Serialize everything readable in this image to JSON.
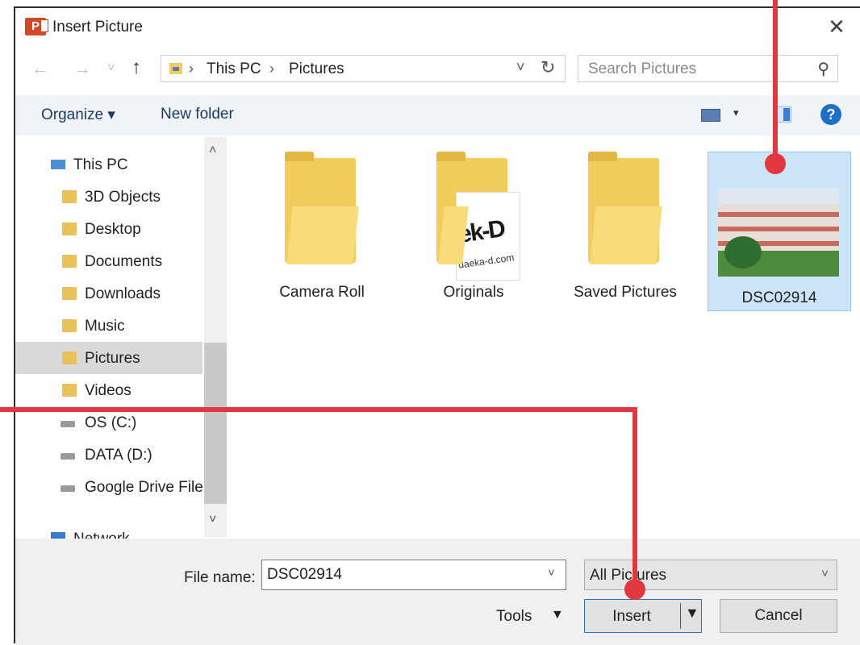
{
  "window": {
    "title": "Insert Picture",
    "close_glyph": "✕",
    "app_icon_letter": "P"
  },
  "nav": {
    "back_glyph": "←",
    "forward_glyph": "→",
    "recent_glyph": "˅",
    "up_glyph": "↑",
    "crumb_sep": "›",
    "breadcrumbs": [
      "This PC",
      "Pictures"
    ],
    "dropdown_glyph": "˅",
    "refresh_glyph": "↻",
    "search_placeholder": "Search Pictures",
    "search_glyph": "⚲"
  },
  "toolbar": {
    "organize": "Organize ▾",
    "new_folder": "New folder",
    "view_dropdown": "▾",
    "help": "?"
  },
  "sidebar": {
    "items": [
      {
        "label": "This PC",
        "icon": "computer-icon"
      },
      {
        "label": "3D Objects",
        "icon": "folder-icon"
      },
      {
        "label": "Desktop",
        "icon": "folder-icon"
      },
      {
        "label": "Documents",
        "icon": "folder-icon"
      },
      {
        "label": "Downloads",
        "icon": "folder-icon"
      },
      {
        "label": "Music",
        "icon": "folder-icon"
      },
      {
        "label": "Pictures",
        "icon": "folder-icon",
        "selected": true
      },
      {
        "label": "Videos",
        "icon": "folder-icon"
      },
      {
        "label": "OS (C:)",
        "icon": "drive-icon"
      },
      {
        "label": "DATA (D:)",
        "icon": "drive-icon"
      },
      {
        "label": "Google Drive File",
        "icon": "drive-icon"
      },
      {
        "label": "Network",
        "icon": "network-icon"
      }
    ],
    "scroll_up": "˄",
    "scroll_down": "˅"
  },
  "content": {
    "items": [
      {
        "label": "Camera Roll",
        "kind": "folder"
      },
      {
        "label": "Originals",
        "kind": "folder-with-image",
        "thumb_text": "ek-D",
        "thumb_sub": "daeka-d.com"
      },
      {
        "label": "Saved Pictures",
        "kind": "folder"
      },
      {
        "label": "DSC02914",
        "kind": "image",
        "selected": true
      }
    ]
  },
  "bottom": {
    "file_name_label": "File name:",
    "file_name_value": "DSC02914",
    "file_type": "All Pictures",
    "dropdown_glyph": "˅",
    "tools_label": "Tools",
    "tools_glyph": "▼",
    "insert_label": "Insert",
    "insert_drop_glyph": "▼",
    "cancel_label": "Cancel"
  },
  "colors": {
    "accent": "#1e6fc5",
    "selection": "#cce4f7",
    "callout": "#e0383e",
    "folder": "#f2cd5c"
  }
}
